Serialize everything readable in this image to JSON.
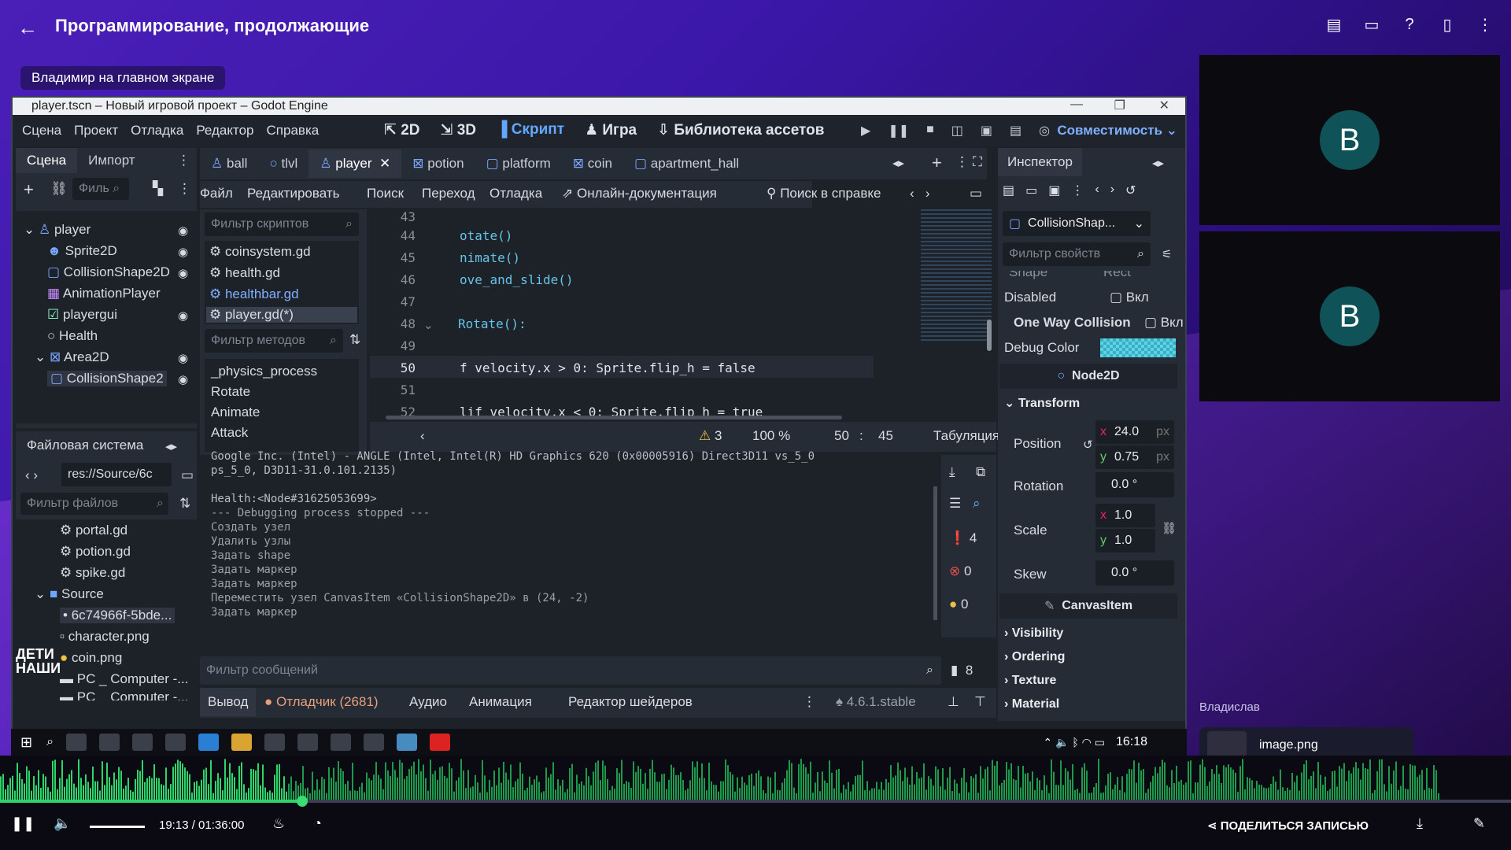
{
  "meeting": {
    "title": "Программирование, продолжающие",
    "presenter_label": "Владимир на главном экране",
    "participant_initial": "В",
    "viewer_name": "Владислав",
    "shared_file": "image.png"
  },
  "godot": {
    "window_title": "player.tscn – Новый игровой проект – Godot Engine",
    "menu": [
      "Сцена",
      "Проект",
      "Отладка",
      "Редактор",
      "Справка"
    ],
    "modes": [
      "2D",
      "3D",
      "Скрипт",
      "Игра",
      "Библиотека ассетов"
    ],
    "compat": "Совместимость",
    "left_tabs": [
      "Сцена",
      "Импорт"
    ],
    "scene_filter": "Филь",
    "scene_tree": [
      "player",
      "Sprite2D",
      "CollisionShape2D",
      "AnimationPlayer",
      "playergui",
      "Health",
      "Area2D",
      "CollisionShape2"
    ],
    "fs_title": "Файловая система",
    "fs_path": "res://Source/6c",
    "fs_filter": "Фильтр файлов",
    "fs_items": [
      "portal.gd",
      "potion.gd",
      "spike.gd",
      "Source",
      "6c74966f-5bde...",
      "character.png",
      "coin.png",
      "PC _ Computer -...",
      "PC _ Computer -..."
    ],
    "script_tabs": [
      "ball",
      "tlvl",
      "player",
      "potion",
      "platform",
      "coin",
      "apartment_hall"
    ],
    "script_menu": [
      "Файл",
      "Редактировать",
      "Поиск",
      "Переход",
      "Отладка"
    ],
    "online_docs": "Онлайн-документация",
    "help_search": "Поиск в справке",
    "script_filter": "Фильтр скриптов",
    "scripts": [
      "coinsystem.gd",
      "health.gd",
      "healthbar.gd",
      "player.gd(*)"
    ],
    "method_filter": "Фильтр методов",
    "methods": [
      "_physics_process",
      "Rotate",
      "Animate",
      "Attack"
    ],
    "code_lines": [
      {
        "n": "43",
        "t": ""
      },
      {
        "n": "44",
        "t": "otate()"
      },
      {
        "n": "45",
        "t": "nimate()"
      },
      {
        "n": "46",
        "t": "ove_and_slide()"
      },
      {
        "n": "47",
        "t": ""
      },
      {
        "n": "48",
        "t": "Rotate():"
      },
      {
        "n": "49",
        "t": ""
      },
      {
        "n": "50",
        "t": "f velocity.x > 0: Sprite.flip_h = false"
      },
      {
        "n": "51",
        "t": ""
      },
      {
        "n": "52",
        "t": "lif velocity.x < 0: Sprite.flip_h = true"
      }
    ],
    "status": {
      "warnings": "3",
      "zoom": "100 %",
      "line": "50",
      "col": "45",
      "indent": "Табуляция"
    },
    "output_lines": [
      "Google Inc. (Intel) - ANGLE (Intel, Intel(R) HD Graphics 620 (0x00005916) Direct3D11 vs_5_0",
      "ps_5_0, D3D11-31.0.101.2135)",
      "",
      "Health:<Node#31625053699>",
      "--- Debugging process stopped ---",
      "Создать узел",
      "Удалить узлы",
      "Задать shape",
      "Задать маркер",
      "Задать маркер",
      "Переместить узел CanvasItem «CollisionShape2D» в (24, -2)",
      "Задать маркер"
    ],
    "msg_filter": "Фильтр сообщений",
    "counts": [
      "4",
      "0",
      "0",
      "8"
    ],
    "bottom_tabs": [
      "Вывод",
      "Отладчик (2681)",
      "Аудио",
      "Анимация",
      "Редактор шейдеров"
    ],
    "version": "4.6.1.stable",
    "inspector": {
      "title": "Инспектор",
      "node": "CollisionShap...",
      "filter": "Фильтр свойств",
      "shape_label": "Shape",
      "shape_val": "Rect",
      "disabled": "Disabled",
      "on": "Вкл",
      "one_way": "One Way Collision",
      "debug_color": "Debug Color",
      "debug_hex": "#5fd3e6",
      "node2d": "Node2D",
      "transform": "Transform",
      "position": "Position",
      "pos_x": "24.0",
      "pos_y": "0.75",
      "px": "px",
      "rotation": "Rotation",
      "rot": "0.0 °",
      "scale": "Scale",
      "scale_x": "1.0",
      "scale_y": "1.0",
      "skew": "Skew",
      "skew_val": "0.0 °",
      "canvasitem": "CanvasItem",
      "sections": [
        "Visibility",
        "Ordering",
        "Texture",
        "Material"
      ]
    },
    "clock": "16:18",
    "watermark": "ДЕТИ НАШИ"
  },
  "playback": {
    "time": "19:13 / 01:36:00",
    "share": "ПОДЕЛИТЬСЯ ЗАПИСЬЮ",
    "progress": 0.2
  }
}
